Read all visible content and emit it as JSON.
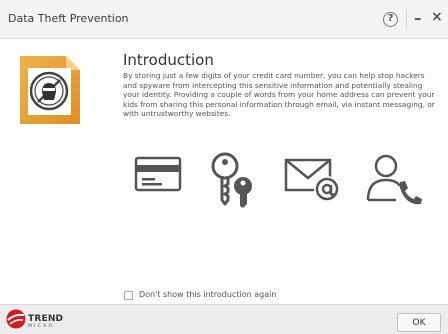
{
  "window": {
    "title": "Data Theft Prevention",
    "help_label": "?",
    "minimize_label": "–",
    "close_label": "×"
  },
  "content": {
    "heading": "Introduction",
    "description": "By storing just a few digits of your credit card number, you can help stop hackers and spyware from intercepting this sensitive information and potentially stealing your identity. Providing a couple of words from your home address can prevent your kids from sharing this personal information through email, via instant messaging, or with untrustworthy websites.",
    "feature_icons": [
      "credit-card-icon",
      "key-icon",
      "email-icon",
      "person-phone-icon"
    ]
  },
  "options": {
    "dont_show_label": "Don't show this introduction again",
    "dont_show_checked": false
  },
  "footer": {
    "brand_name": "TREND",
    "brand_sub": "MICRO",
    "ok_label": "OK"
  },
  "colors": {
    "accent_orange": "#e8a23c",
    "icon_gray": "#555555",
    "brand_red": "#d71920"
  }
}
